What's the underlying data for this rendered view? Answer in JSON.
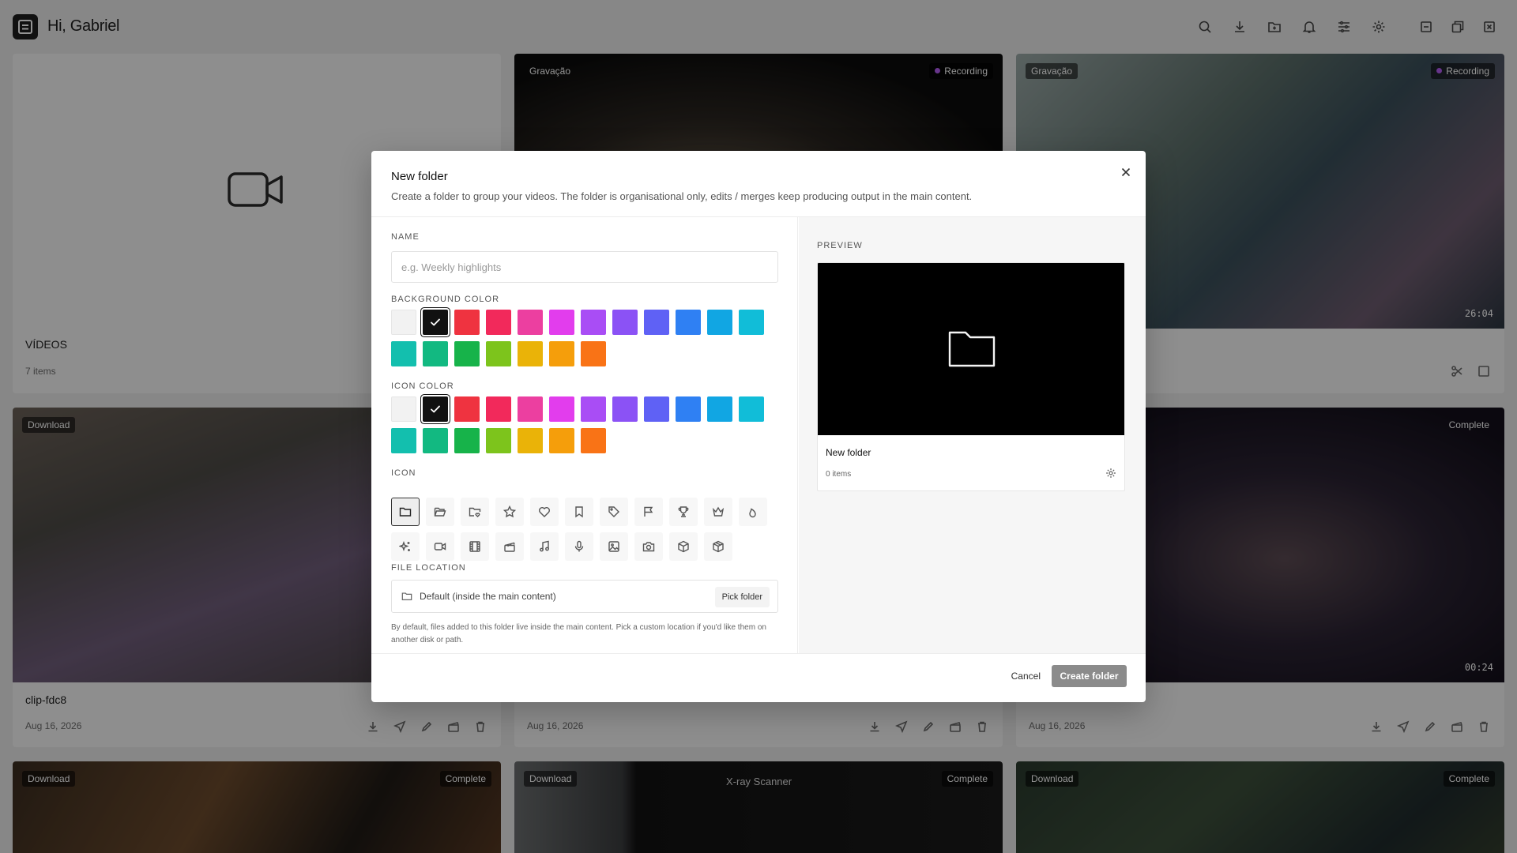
{
  "header": {
    "greeting": "Hi, Gabriel",
    "icons": [
      "search-icon",
      "download-icon",
      "folder-plus-icon",
      "bell-icon",
      "sliders-icon",
      "gear-icon",
      "minimize-icon",
      "restore-icon",
      "close-icon"
    ]
  },
  "grid": {
    "videos_folder": {
      "title": "VÍDEOS",
      "count": "7 items"
    },
    "cards": [
      {
        "badge": "Gravação",
        "status": "Recording",
        "title": "",
        "date": ""
      },
      {
        "badge": "Gravação",
        "status": "Recording",
        "title": "",
        "date": "",
        "duration": "26:04"
      },
      {
        "badge": "Download",
        "status": "",
        "title": "clip-fdc8",
        "date": "Aug 16, 2026"
      },
      {
        "badge": "",
        "status": "",
        "title": "",
        "date": "Aug 16, 2026"
      },
      {
        "badge": "",
        "status": "Complete",
        "title": "",
        "date": "Aug 16, 2026",
        "duration": "00:24"
      },
      {
        "badge": "Download",
        "status": "Complete",
        "title": ""
      },
      {
        "badge": "Download",
        "status": "Complete",
        "title": "X-ray Scanner"
      },
      {
        "badge": "Download",
        "status": "Complete",
        "title": ""
      }
    ]
  },
  "modal": {
    "title": "New folder",
    "subtitle": "Create a folder to group your videos. The folder is organisational only, edits / merges keep producing output in the main content.",
    "name_label": "NAME",
    "name_placeholder": "e.g. Weekly highlights",
    "name_value": "",
    "bg_color_label": "BACKGROUND COLOR",
    "icon_color_label": "ICON COLOR",
    "colors": [
      "#f2f2f2",
      "#111111",
      "#ef3340",
      "#f2295b",
      "#ec3fa0",
      "#e23ded",
      "#a94df5",
      "#8b52f5",
      "#5f61f5",
      "#2f80f3",
      "#11a6e3",
      "#11bdd8",
      "#13bfae",
      "#12b981",
      "#17b34a",
      "#7dc41c",
      "#eab308",
      "#f59e0b",
      "#f97316"
    ],
    "selected_bg_color": "#111111",
    "selected_icon_color": "#111111",
    "icon_label": "ICON",
    "icons": [
      "folder-icon",
      "folder-open-icon",
      "folder-heart-icon",
      "star-icon",
      "heart-icon",
      "bookmark-icon",
      "tag-icon",
      "flag-icon",
      "trophy-icon",
      "crown-icon",
      "flame-icon",
      "sparkles-icon",
      "video-icon",
      "film-icon",
      "clapperboard-icon",
      "music-icon",
      "mic-icon",
      "image-icon",
      "camera-icon",
      "box-icon",
      "package-icon"
    ],
    "selected_icon": "folder-icon",
    "file_location_label": "FILE LOCATION",
    "file_location_value": "Default (inside the main content)",
    "pick_folder_label": "Pick folder",
    "file_location_help": "By default, files added to this folder live inside the main content. Pick a custom location if you'd like them on another disk or path.",
    "preview_label": "PREVIEW",
    "preview_name": "New folder",
    "preview_count": "0 items",
    "cancel_label": "Cancel",
    "create_label": "Create folder"
  }
}
